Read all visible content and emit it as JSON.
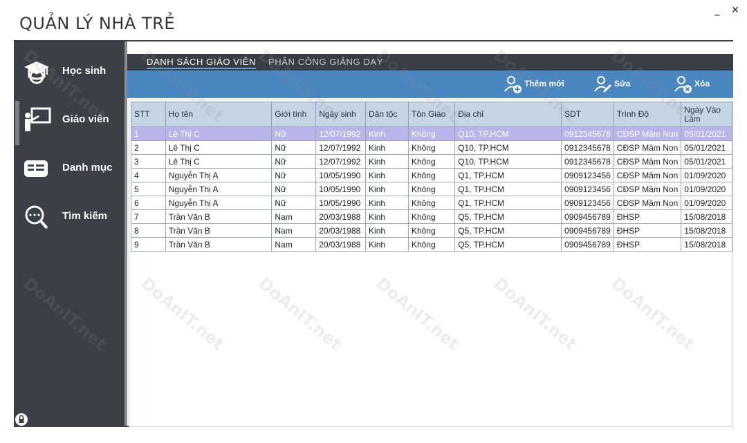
{
  "window": {
    "title": "QUẢN LÝ NHÀ TRẺ",
    "minimize": "_",
    "close": "✕"
  },
  "sidebar": {
    "items": [
      {
        "label": "Học sinh",
        "icon": "student-cap-icon"
      },
      {
        "label": "Giáo viên",
        "icon": "teacher-board-icon"
      },
      {
        "label": "Danh mục",
        "icon": "catalog-card-icon"
      },
      {
        "label": "Tìm kiếm",
        "icon": "search-icon"
      }
    ],
    "active_index": 1,
    "lock_icon": "lock-icon"
  },
  "tabs": [
    {
      "label": "DANH SÁCH GIÁO VIÊN",
      "active": true
    },
    {
      "label": "PHÂN CÔNG GIẢNG DẠY",
      "active": false
    }
  ],
  "toolbar": {
    "add_label": "Thêm mới",
    "edit_label": "Sửa",
    "delete_label": "Xóa"
  },
  "table": {
    "headers": [
      "STT",
      "Họ tên",
      "Giới tính",
      "Ngày sinh",
      "Dân tộc",
      "Tôn Giáo",
      "Địa chỉ",
      "SDT",
      "Trình Độ",
      "Ngày Vào Làm"
    ],
    "rows": [
      [
        "1",
        "Lê Thị C",
        "Nữ",
        "12/07/1992",
        "Kinh",
        "Không",
        "Q10, TP.HCM",
        "0912345678",
        "CĐSP Mầm Non",
        "05/01/2021"
      ],
      [
        "2",
        "Lê Thị C",
        "Nữ",
        "12/07/1992",
        "Kinh",
        "Không",
        "Q10, TP.HCM",
        "0912345678",
        "CĐSP Mầm Non",
        "05/01/2021"
      ],
      [
        "3",
        "Lê Thị C",
        "Nữ",
        "12/07/1992",
        "Kinh",
        "Không",
        "Q10, TP.HCM",
        "0912345678",
        "CĐSP Mầm Non",
        "05/01/2021"
      ],
      [
        "4",
        "Nguyễn Thị A",
        "Nữ",
        "10/05/1990",
        "Kinh",
        "Không",
        "Q1, TP.HCM",
        "0909123456",
        "CĐSP Mầm Non",
        "01/09/2020"
      ],
      [
        "5",
        "Nguyễn Thị A",
        "Nữ",
        "10/05/1990",
        "Kinh",
        "Không",
        "Q1, TP.HCM",
        "0909123456",
        "CĐSP Mầm Non",
        "01/09/2020"
      ],
      [
        "6",
        "Nguyễn Thị A",
        "Nữ",
        "10/05/1990",
        "Kinh",
        "Không",
        "Q1, TP.HCM",
        "0909123456",
        "CĐSP Mầm Non",
        "01/09/2020"
      ],
      [
        "7",
        "Trần Văn B",
        "Nam",
        "20/03/1988",
        "Kinh",
        "Không",
        "Q5, TP.HCM",
        "0909456789",
        "ĐHSP",
        "15/08/2018"
      ],
      [
        "8",
        "Trần Văn B",
        "Nam",
        "20/03/1988",
        "Kinh",
        "Không",
        "Q5, TP.HCM",
        "0909456789",
        "ĐHSP",
        "15/08/2018"
      ],
      [
        "9",
        "Trần Văn B",
        "Nam",
        "20/03/1988",
        "Kinh",
        "Không",
        "Q5, TP.HCM",
        "0909456789",
        "ĐHSP",
        "15/08/2018"
      ]
    ],
    "selected_row": 0
  },
  "watermark": "DoAnIT.net",
  "colors": {
    "sidebar": "#3c4046",
    "toolbar": "#4a86bf",
    "header": "#c5d5e6",
    "selected_row": "#b9b5ea",
    "tab_underline": "#5da3d8"
  }
}
